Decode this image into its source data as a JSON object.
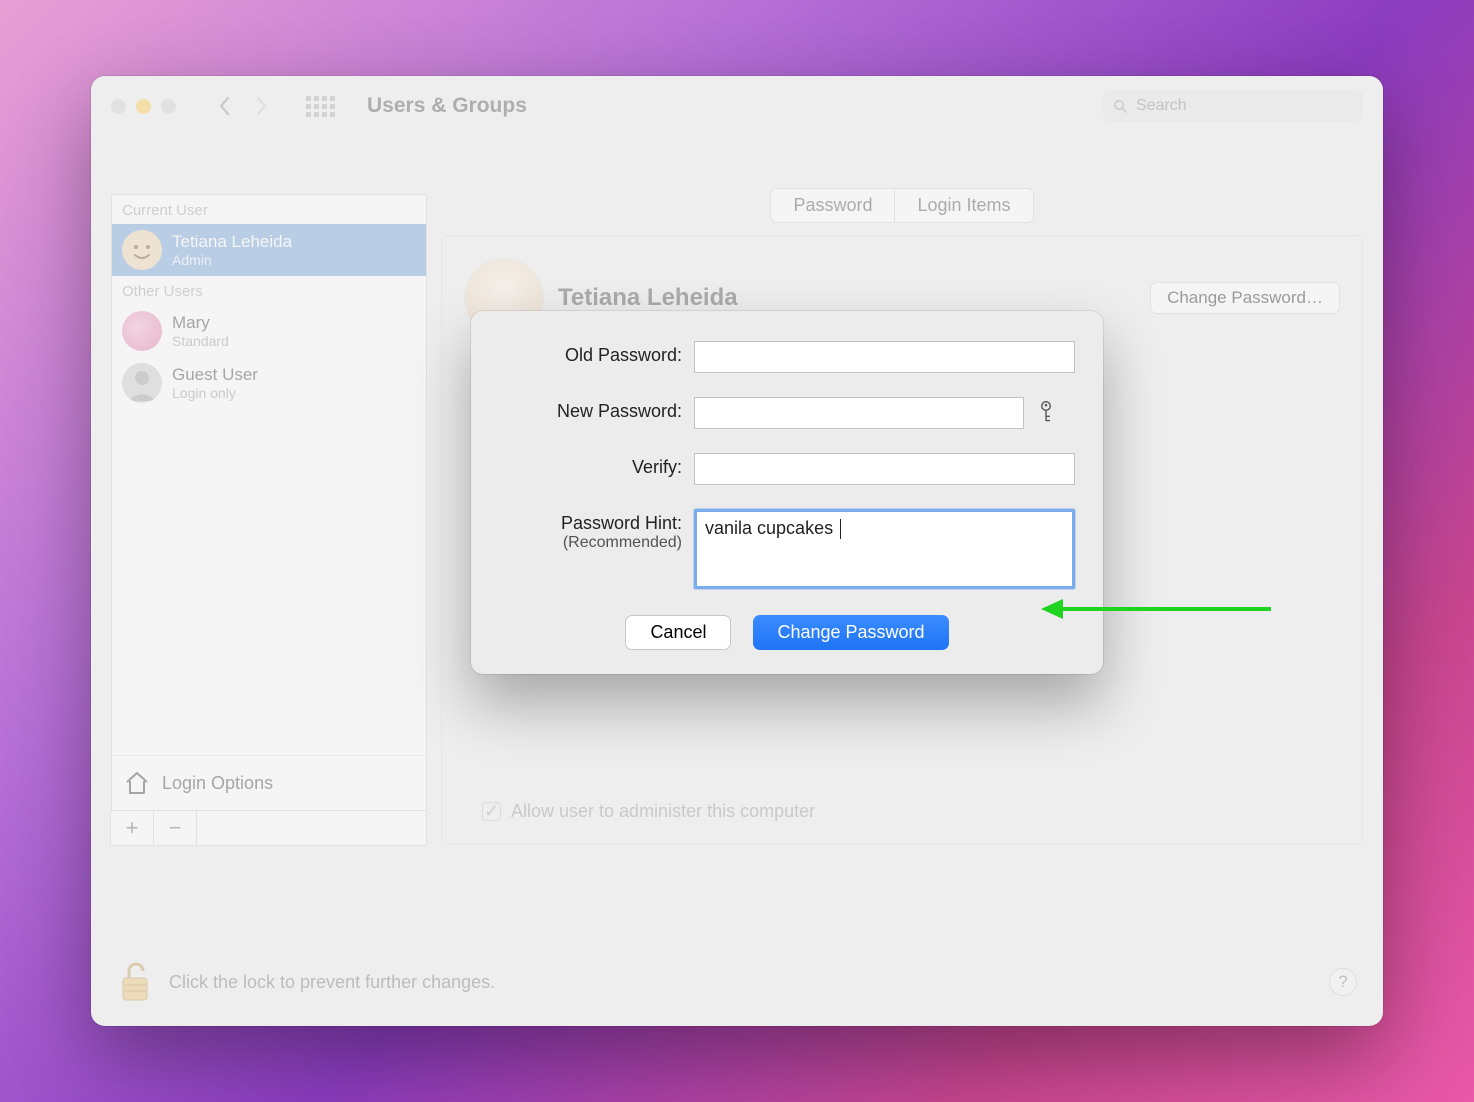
{
  "window": {
    "title": "Users & Groups",
    "search_placeholder": "Search"
  },
  "sidebar": {
    "section_current": "Current User",
    "section_other": "Other Users",
    "current_user": {
      "name": "Tetiana Leheida",
      "role": "Admin"
    },
    "other_users": [
      {
        "name": "Mary",
        "role": "Standard"
      },
      {
        "name": "Guest User",
        "role": "Login only"
      }
    ],
    "login_options_label": "Login Options"
  },
  "tabs": {
    "password": "Password",
    "login_items": "Login Items"
  },
  "main": {
    "profile_name": "Tetiana Leheida",
    "change_password_btn": "Change Password…",
    "allow_admin_label": "Allow user to administer this computer"
  },
  "modal": {
    "old_password_label": "Old Password:",
    "new_password_label": "New Password:",
    "verify_label": "Verify:",
    "hint_label": "Password Hint:",
    "hint_sublabel": "(Recommended)",
    "hint_value": "vanila cupcakes ",
    "cancel": "Cancel",
    "submit": "Change Password"
  },
  "lockbar": {
    "text": "Click the lock to prevent further changes.",
    "help": "?"
  }
}
